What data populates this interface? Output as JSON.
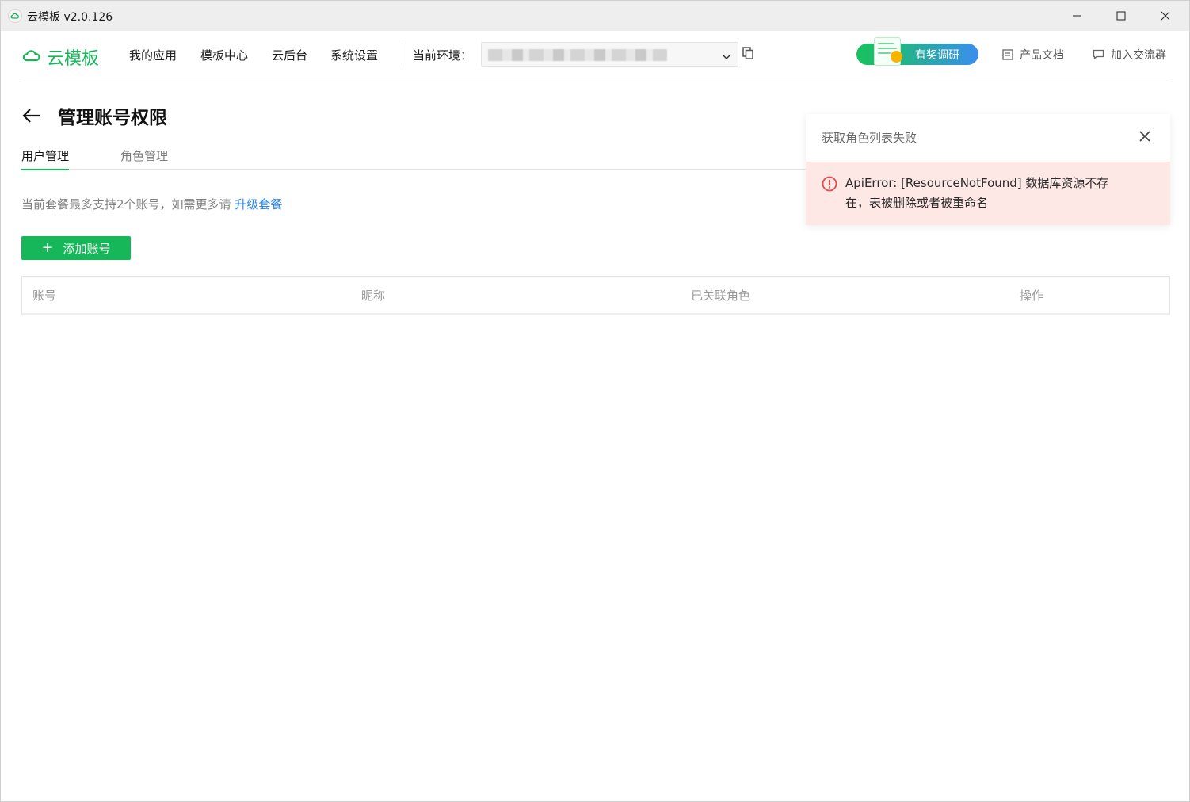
{
  "window": {
    "title": "云模板 v2.0.126"
  },
  "nav": {
    "brand": "云模板",
    "items": [
      "我的应用",
      "模板中心",
      "云后台",
      "系统设置"
    ],
    "env_label": "当前环境：",
    "survey": "有奖调研",
    "docs": "产品文档",
    "join_group": "加入交流群"
  },
  "page": {
    "title": "管理账号权限",
    "tabs": [
      "用户管理",
      "角色管理"
    ],
    "active_tab": "用户管理",
    "quota_text": "当前套餐最多支持2个账号，如需更多请 ",
    "upgrade_link": "升级套餐",
    "add_button": "添加账号"
  },
  "table": {
    "columns": [
      "账号",
      "昵称",
      "已关联角色",
      "操作"
    ],
    "rows": []
  },
  "toast": {
    "title": "获取角色列表失败",
    "message": "ApiError: [ResourceNotFound] 数据库资源不存在，表被删除或者被重命名"
  },
  "colors": {
    "brand_green": "#16b758",
    "link_blue": "#2b84e6",
    "error_red": "#e5484d",
    "error_bg": "#fde8e6"
  },
  "icons": {
    "app": "cloud-app-icon",
    "brand": "cloud-icon",
    "back": "arrow-left-icon",
    "copy": "copy-icon",
    "docs": "document-icon",
    "group": "chat-bubble-icon",
    "close": "close-icon",
    "error": "error-circle-icon"
  }
}
